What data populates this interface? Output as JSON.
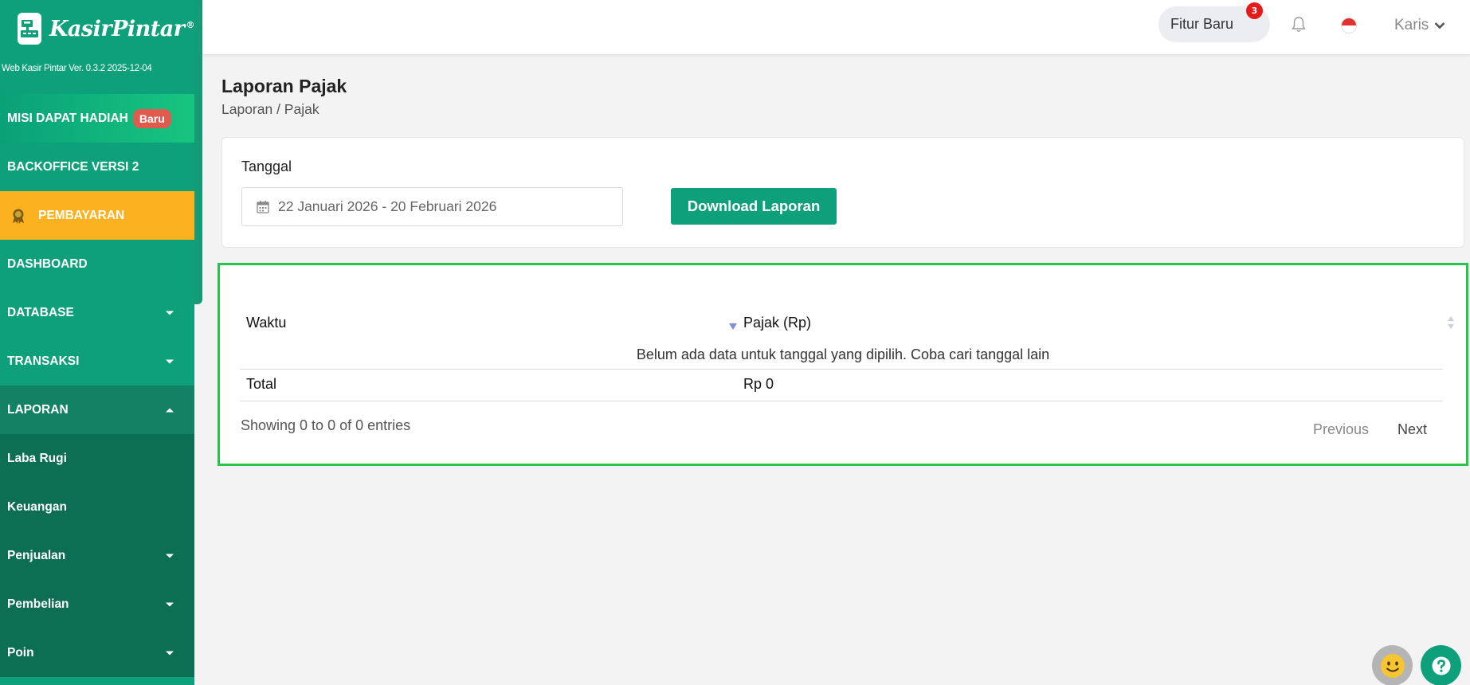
{
  "brand": {
    "name": "Kasir",
    "name_accent": "Pintar",
    "registered": "®",
    "version": "Web Kasir Pintar Ver. 0.3.2 2025-12-04"
  },
  "sidebar": {
    "items": [
      {
        "label": "MISI DAPAT HADIAH",
        "badge": "Baru"
      },
      {
        "label": "BACKOFFICE VERSI 2"
      },
      {
        "label": "PEMBAYARAN"
      },
      {
        "label": "DASHBOARD"
      },
      {
        "label": "DATABASE"
      },
      {
        "label": "TRANSAKSI"
      },
      {
        "label": "LAPORAN"
      },
      {
        "label": "Laba Rugi"
      },
      {
        "label": "Keuangan"
      },
      {
        "label": "Penjualan"
      },
      {
        "label": "Pembelian"
      },
      {
        "label": "Poin"
      }
    ]
  },
  "topbar": {
    "fitur_label": "Fitur Baru",
    "fitur_count": "3",
    "user_name": "Karis"
  },
  "page": {
    "title": "Laporan Pajak",
    "breadcrumb": "Laporan / Pajak"
  },
  "filter": {
    "label": "Tanggal",
    "date_value": "22 Januari 2026 - 20 Februari 2026",
    "download_label": "Download Laporan"
  },
  "table": {
    "columns": [
      "Waktu",
      "Pajak (Rp)"
    ],
    "empty_message": "Belum ada data untuk tanggal yang dipilih. Coba cari tanggal lain",
    "total_label": "Total",
    "total_value": "Rp 0",
    "showing": "Showing 0 to 0 of 0 entries",
    "previous": "Previous",
    "next": "Next"
  },
  "colors": {
    "primary": "#0ea07a",
    "payment": "#fbb120",
    "highlight_border": "#27c54a",
    "badge": "#e05b4e",
    "notif": "#e31b1b"
  },
  "icons": [
    "logo-register-icon",
    "medal-icon",
    "caret-down-icon",
    "caret-up-icon",
    "bell-icon",
    "flag-icon",
    "chevron-down-icon",
    "calendar-icon",
    "sort-desc-icon",
    "sort-icon",
    "smiley-icon",
    "help-icon"
  ]
}
